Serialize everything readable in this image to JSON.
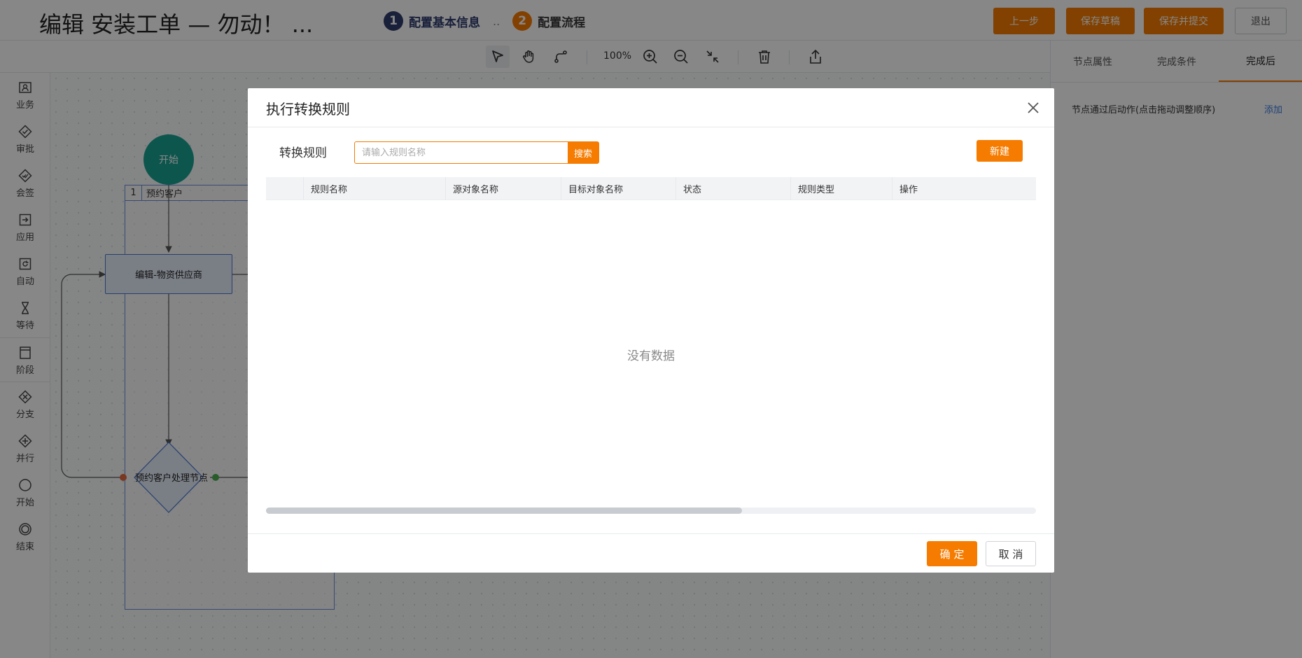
{
  "header": {
    "title": "编辑 安装工单 — 勿动！ ...",
    "steps": [
      {
        "num": "1",
        "label": "配置基本信息"
      },
      {
        "num": "2",
        "label": "配置流程"
      }
    ],
    "step_separator": "..",
    "buttons": {
      "prev": "上一步",
      "save_draft": "保存草稿",
      "save_submit": "保存并提交",
      "exit": "退出"
    }
  },
  "toolbar": {
    "zoom": "100%",
    "icons": [
      "select-pointer-icon",
      "hand-pan-icon",
      "connect-line-icon",
      "zoom-in-icon",
      "zoom-out-icon",
      "fit-shrink-icon",
      "delete-trash-icon",
      "export-share-icon"
    ]
  },
  "palette": {
    "items": [
      {
        "label": "业务",
        "icon": "business-icon"
      },
      {
        "label": "审批",
        "icon": "approve-icon"
      },
      {
        "label": "会签",
        "icon": "countersign-icon"
      },
      {
        "label": "应用",
        "icon": "application-icon"
      },
      {
        "label": "自动",
        "icon": "auto-icon"
      },
      {
        "label": "等待",
        "icon": "hourglass-icon"
      },
      {
        "label": "阶段",
        "icon": "stage-icon"
      },
      {
        "label": "分支",
        "icon": "branch-icon"
      },
      {
        "label": "并行",
        "icon": "parallel-icon"
      },
      {
        "label": "开始",
        "icon": "start-circle-icon"
      },
      {
        "label": "结束",
        "icon": "end-circle-icon"
      }
    ]
  },
  "canvas": {
    "lane": {
      "num": "1",
      "name": "预约客户"
    },
    "start_node": "开始",
    "task_node": "编辑-物资供应商",
    "gateway_node": "预约客户处理节点"
  },
  "right_panel": {
    "tabs": [
      "节点属性",
      "完成条件",
      "完成后"
    ],
    "active_tab": "完成后",
    "row_label": "节点通过后动作(点击拖动调整顺序)",
    "add_link": "添加"
  },
  "modal": {
    "title": "执行转换规则",
    "rule_label": "转换规则",
    "search_placeholder": "请输入规则名称",
    "search_value": "",
    "search_button": "搜索",
    "new_button": "新建",
    "columns": [
      "",
      "规则名称",
      "源对象名称",
      "目标对象名称",
      "状态",
      "规则类型",
      "操作"
    ],
    "rows": [],
    "empty_text": "没有数据",
    "ok_button": "确 定",
    "cancel_button": "取 消"
  },
  "colors": {
    "accent": "#f57c00",
    "step_active": "#303d6e",
    "start_node": "#1aa393",
    "lane_border": "#6a8fd6",
    "link": "#3a7be0"
  }
}
